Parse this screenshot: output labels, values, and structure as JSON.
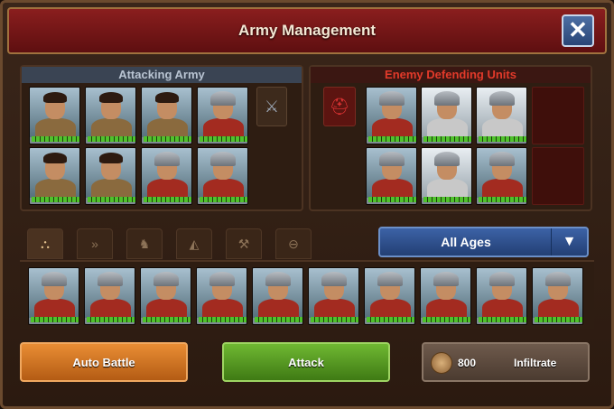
{
  "window": {
    "title": "Army Management",
    "close_symbol": "✕"
  },
  "attacking_army": {
    "header": "Attacking Army",
    "units": [
      "warrior",
      "warrior",
      "warrior",
      "soldier",
      "warrior",
      "warrior",
      "soldier",
      "soldier"
    ],
    "side_icon": "crossed-swords-icon"
  },
  "enemy": {
    "header": "Enemy Defending Units",
    "units": [
      "soldier",
      "legion",
      "legion",
      "soldier",
      "legion",
      "soldier"
    ],
    "side_icon": "helmet-icon"
  },
  "tabs": [
    {
      "icon": "all-units-icon",
      "glyph": "⛬",
      "active": true
    },
    {
      "icon": "fast-units-icon",
      "glyph": "»",
      "active": false
    },
    {
      "icon": "heavy-units-icon",
      "glyph": "♞",
      "active": false
    },
    {
      "icon": "light-units-icon",
      "glyph": "◭",
      "active": false
    },
    {
      "icon": "artillery-units-icon",
      "glyph": "⚒",
      "active": false
    },
    {
      "icon": "ranged-units-icon",
      "glyph": "⊖",
      "active": false
    }
  ],
  "age_filter": {
    "selected": "All Ages"
  },
  "reserve_units_count": 10,
  "buttons": {
    "auto_battle": "Auto Battle",
    "attack": "Attack",
    "infiltrate": "Infiltrate",
    "infiltrate_cost": "800"
  },
  "colors": {
    "hp_bar": "#4fc22c",
    "title_bar": "#8a1e1e",
    "enemy_header": "#e23a2a"
  }
}
